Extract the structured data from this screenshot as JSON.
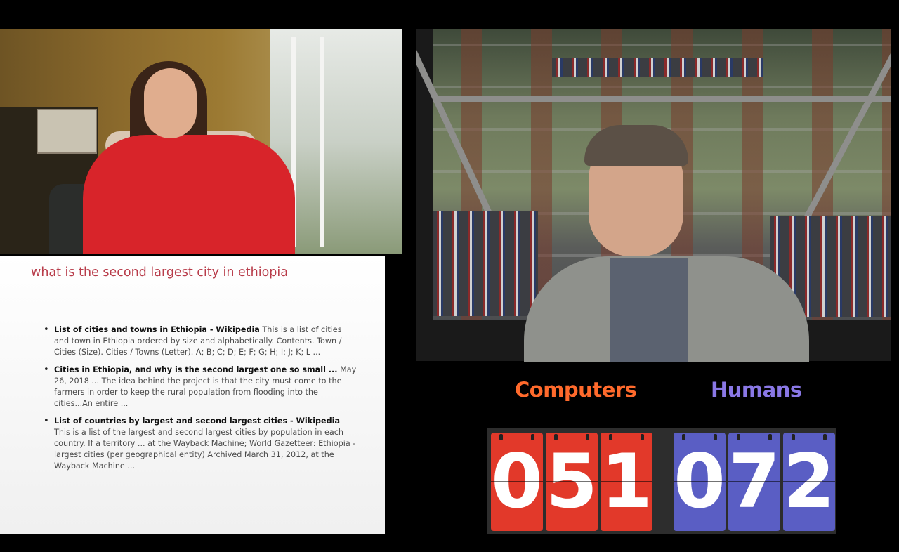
{
  "slide": {
    "title": "what is the second largest city in ethiopia",
    "results": [
      {
        "title": "List of cities and towns in Ethiopia - Wikipedia",
        "snippet": "This is a list of cities and town in Ethiopia ordered by size and alphabetically. Contents. Town / Cities (Size). Cities / Towns (Letter). A; B; C; D; E; F; G; H; I; J; K; L ..."
      },
      {
        "title": "Cities in Ethiopia, and why is the second largest one so small ...",
        "snippet": "May 26, 2018 ... The idea behind the project is that the city must come to the farmers in order to keep the rural population from flooding into the cities...An entire ..."
      },
      {
        "title": "List of countries by largest and second largest cities - Wikipedia",
        "snippet": "This is a list of the largest and second largest cities by population in each country. If a territory ... at the Wayback Machine; World Gazetteer: Ethiopia - largest cities (per geographical entity) Archived March 31, 2012, at the Wayback Machine ..."
      }
    ]
  },
  "scoreboard": {
    "computers_label": "Computers",
    "humans_label": "Humans",
    "computers_digits": [
      "0",
      "5",
      "1"
    ],
    "humans_digits": [
      "0",
      "7",
      "2"
    ],
    "computers_color": "#ff6a2c",
    "humans_color": "#8a78e6",
    "computers_card_color": "#e2392a",
    "humans_card_color": "#5a5ec4"
  }
}
